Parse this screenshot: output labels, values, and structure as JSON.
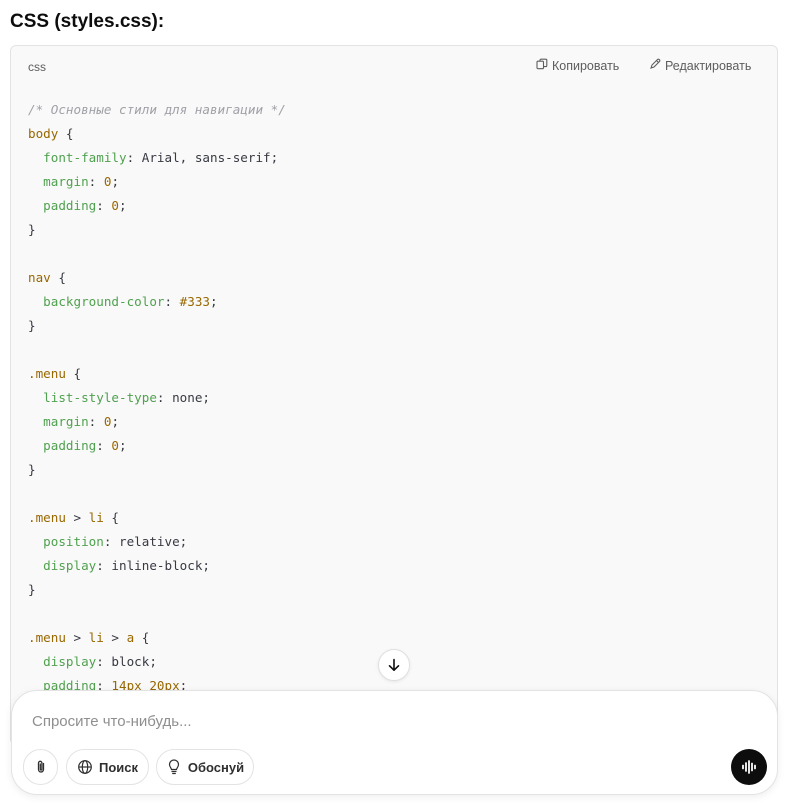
{
  "heading": "CSS (styles.css):",
  "code_block": {
    "language": "css",
    "copy_label": "Копировать",
    "edit_label": "Редактировать",
    "lines": [
      [
        {
          "t": "cm",
          "v": "/* Основные стили для навигации */"
        }
      ],
      [
        {
          "t": "sel",
          "v": "body"
        },
        {
          "t": "kw",
          "v": " {"
        }
      ],
      [
        {
          "t": "kw",
          "v": "  "
        },
        {
          "t": "pr",
          "v": "font-family"
        },
        {
          "t": "kw",
          "v": ": Arial, sans-serif;"
        }
      ],
      [
        {
          "t": "kw",
          "v": "  "
        },
        {
          "t": "pr",
          "v": "margin"
        },
        {
          "t": "kw",
          "v": ": "
        },
        {
          "t": "num",
          "v": "0"
        },
        {
          "t": "kw",
          "v": ";"
        }
      ],
      [
        {
          "t": "kw",
          "v": "  "
        },
        {
          "t": "pr",
          "v": "padding"
        },
        {
          "t": "kw",
          "v": ": "
        },
        {
          "t": "num",
          "v": "0"
        },
        {
          "t": "kw",
          "v": ";"
        }
      ],
      [
        {
          "t": "kw",
          "v": "}"
        }
      ],
      [],
      [
        {
          "t": "sel",
          "v": "nav"
        },
        {
          "t": "kw",
          "v": " {"
        }
      ],
      [
        {
          "t": "kw",
          "v": "  "
        },
        {
          "t": "pr",
          "v": "background-color"
        },
        {
          "t": "kw",
          "v": ": "
        },
        {
          "t": "num",
          "v": "#333"
        },
        {
          "t": "kw",
          "v": ";"
        }
      ],
      [
        {
          "t": "kw",
          "v": "}"
        }
      ],
      [],
      [
        {
          "t": "sel",
          "v": ".menu"
        },
        {
          "t": "kw",
          "v": " {"
        }
      ],
      [
        {
          "t": "kw",
          "v": "  "
        },
        {
          "t": "pr",
          "v": "list-style-type"
        },
        {
          "t": "kw",
          "v": ": none;"
        }
      ],
      [
        {
          "t": "kw",
          "v": "  "
        },
        {
          "t": "pr",
          "v": "margin"
        },
        {
          "t": "kw",
          "v": ": "
        },
        {
          "t": "num",
          "v": "0"
        },
        {
          "t": "kw",
          "v": ";"
        }
      ],
      [
        {
          "t": "kw",
          "v": "  "
        },
        {
          "t": "pr",
          "v": "padding"
        },
        {
          "t": "kw",
          "v": ": "
        },
        {
          "t": "num",
          "v": "0"
        },
        {
          "t": "kw",
          "v": ";"
        }
      ],
      [
        {
          "t": "kw",
          "v": "}"
        }
      ],
      [],
      [
        {
          "t": "sel",
          "v": ".menu"
        },
        {
          "t": "kw",
          "v": " > "
        },
        {
          "t": "sel",
          "v": "li"
        },
        {
          "t": "kw",
          "v": " {"
        }
      ],
      [
        {
          "t": "kw",
          "v": "  "
        },
        {
          "t": "pr",
          "v": "position"
        },
        {
          "t": "kw",
          "v": ": relative;"
        }
      ],
      [
        {
          "t": "kw",
          "v": "  "
        },
        {
          "t": "pr",
          "v": "display"
        },
        {
          "t": "kw",
          "v": ": inline-block;"
        }
      ],
      [
        {
          "t": "kw",
          "v": "}"
        }
      ],
      [],
      [
        {
          "t": "sel",
          "v": ".menu"
        },
        {
          "t": "kw",
          "v": " > "
        },
        {
          "t": "sel",
          "v": "li"
        },
        {
          "t": "kw",
          "v": " > "
        },
        {
          "t": "sel",
          "v": "a"
        },
        {
          "t": "kw",
          "v": " {"
        }
      ],
      [
        {
          "t": "kw",
          "v": "  "
        },
        {
          "t": "pr",
          "v": "display"
        },
        {
          "t": "kw",
          "v": ": block;"
        }
      ],
      [
        {
          "t": "kw",
          "v": "  "
        },
        {
          "t": "pr",
          "v": "padding"
        },
        {
          "t": "kw",
          "v": ": "
        },
        {
          "t": "num",
          "v": "14px 20px"
        },
        {
          "t": "kw",
          "v": ";"
        }
      ]
    ]
  },
  "composer": {
    "placeholder": "Спросите что-нибудь...",
    "search_label": "Поиск",
    "reason_label": "Обоснуй"
  },
  "icons": {
    "copy": "copy-icon",
    "edit": "pencil-icon",
    "scroll": "arrow-down-icon",
    "attach": "paperclip-icon",
    "search": "globe-icon",
    "reason": "lightbulb-icon",
    "voice": "voice-waveform-icon"
  },
  "colors": {
    "comment": "#a0a1a7",
    "selector": "#986801",
    "property": "#50a14f",
    "code_bg": "#f9f9f9",
    "voice_button": "#0d0d0d"
  }
}
